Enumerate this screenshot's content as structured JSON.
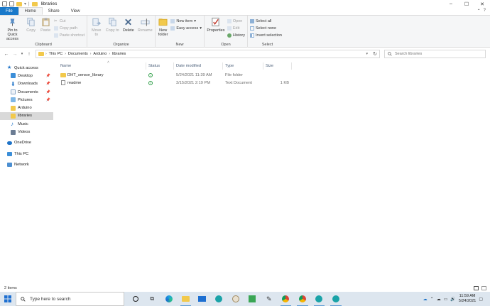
{
  "window": {
    "title": "libraries",
    "controls": [
      "–",
      "☐",
      "✕"
    ]
  },
  "tabs": [
    {
      "label": "File"
    },
    {
      "label": "Home"
    },
    {
      "label": "Share"
    },
    {
      "label": "View"
    }
  ],
  "ribbon": {
    "clipboard": {
      "label": "Clipboard",
      "pin": "Pin to Quick access",
      "copy": "Copy",
      "paste": "Paste",
      "cut": "Cut",
      "copy_path": "Copy path",
      "paste_shortcut": "Paste shortcut"
    },
    "organize": {
      "label": "Organize",
      "move_to": "Move to",
      "copy_to": "Copy to",
      "delete": "Delete",
      "rename": "Rename"
    },
    "new": {
      "label": "New",
      "new_folder": "New folder",
      "new_item": "New item",
      "easy_access": "Easy access"
    },
    "open": {
      "label": "Open",
      "properties": "Properties",
      "open": "Open",
      "edit": "Edit",
      "history": "History"
    },
    "select": {
      "label": "Select",
      "select_all": "Select all",
      "select_none": "Select none",
      "invert_selection": "Invert selection"
    }
  },
  "address": {
    "crumbs": [
      "This PC",
      "Documents",
      "Arduino",
      "libraries"
    ],
    "search_placeholder": "Search libraries"
  },
  "nav": [
    {
      "label": "Quick access",
      "icon": "star-icon",
      "pinned": false
    },
    {
      "label": "Desktop",
      "icon": "desktop-icon",
      "pinned": true
    },
    {
      "label": "Downloads",
      "icon": "download-icon",
      "pinned": true
    },
    {
      "label": "Documents",
      "icon": "documents-icon",
      "pinned": true
    },
    {
      "label": "Pictures",
      "icon": "pictures-icon",
      "pinned": true
    },
    {
      "label": "Arduino",
      "icon": "folder-icon",
      "pinned": false
    },
    {
      "label": "libraries",
      "icon": "folder-icon",
      "pinned": false
    },
    {
      "label": "Music",
      "icon": "music-icon",
      "pinned": false
    },
    {
      "label": "Videos",
      "icon": "videos-icon",
      "pinned": false
    },
    {
      "label": "OneDrive",
      "icon": "onedrive-icon",
      "pinned": false
    },
    {
      "label": "This PC",
      "icon": "pc-icon",
      "pinned": false
    },
    {
      "label": "Network",
      "icon": "network-icon",
      "pinned": false
    }
  ],
  "columns": {
    "name": "Name",
    "status": "Status",
    "date": "Date modified",
    "type": "Type",
    "size": "Size"
  },
  "files": [
    {
      "name": "DHT_sensor_library",
      "icon": "folder-icon",
      "date": "5/24/2021 11:39 AM",
      "type": "File folder",
      "size": ""
    },
    {
      "name": "readme",
      "icon": "text-document-icon",
      "date": "3/15/2021 2:19 PM",
      "type": "Text Document",
      "size": "1 KB"
    }
  ],
  "status": {
    "items": "2 items"
  },
  "taskbar": {
    "search_placeholder": "Type here to search",
    "time": "11:59 AM",
    "date": "5/24/2021"
  },
  "colors": {
    "file_tab": "#1979ca",
    "selected_nav": "#d9d9d9",
    "taskbar": "#dde6ef",
    "folder": "#f2c94c"
  }
}
